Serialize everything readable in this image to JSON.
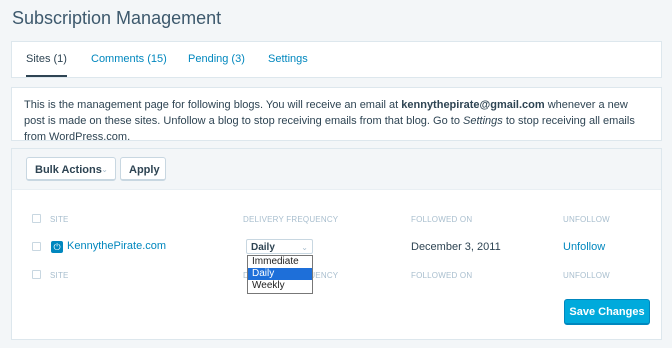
{
  "page": {
    "title": "Subscription Management"
  },
  "tabs": [
    {
      "label": "Sites (1)",
      "active": true
    },
    {
      "label": "Comments (15)",
      "active": false
    },
    {
      "label": "Pending (3)",
      "active": false
    },
    {
      "label": "Settings",
      "active": false
    }
  ],
  "notice": {
    "text_before_email": "This is the management page for following blogs. You will receive an email at ",
    "email": "kennythepirate@gmail.com",
    "text_after_email": " whenever a new post is made on these sites. Unfollow a blog to stop receiving emails from that blog. Go to ",
    "settings_link": "Settings",
    "text_end": " to stop receiving all emails from WordPress.com."
  },
  "toolbar": {
    "bulk_actions_label": "Bulk Actions",
    "apply_label": "Apply"
  },
  "table": {
    "headers": {
      "site": "SITE",
      "delivery": "DELIVERY FREQUENCY",
      "followed": "FOLLOWED ON",
      "unfollow": "UNFOLLOW"
    },
    "rows": [
      {
        "site": "KennythePirate.com",
        "frequency": "Daily",
        "followed_on": "December 3, 2011",
        "action": "Unfollow"
      }
    ]
  },
  "frequency_dropdown": {
    "options": [
      "Immediate",
      "Daily",
      "Weekly"
    ],
    "selected": "Daily"
  },
  "save_label": "Save Changes",
  "icons": {
    "site": "site-power-icon",
    "chevron": "chevron-down-icon"
  },
  "colors": {
    "accent": "#0087be",
    "primary_button": "#00aadc",
    "selected_option": "#1e6fd9"
  }
}
